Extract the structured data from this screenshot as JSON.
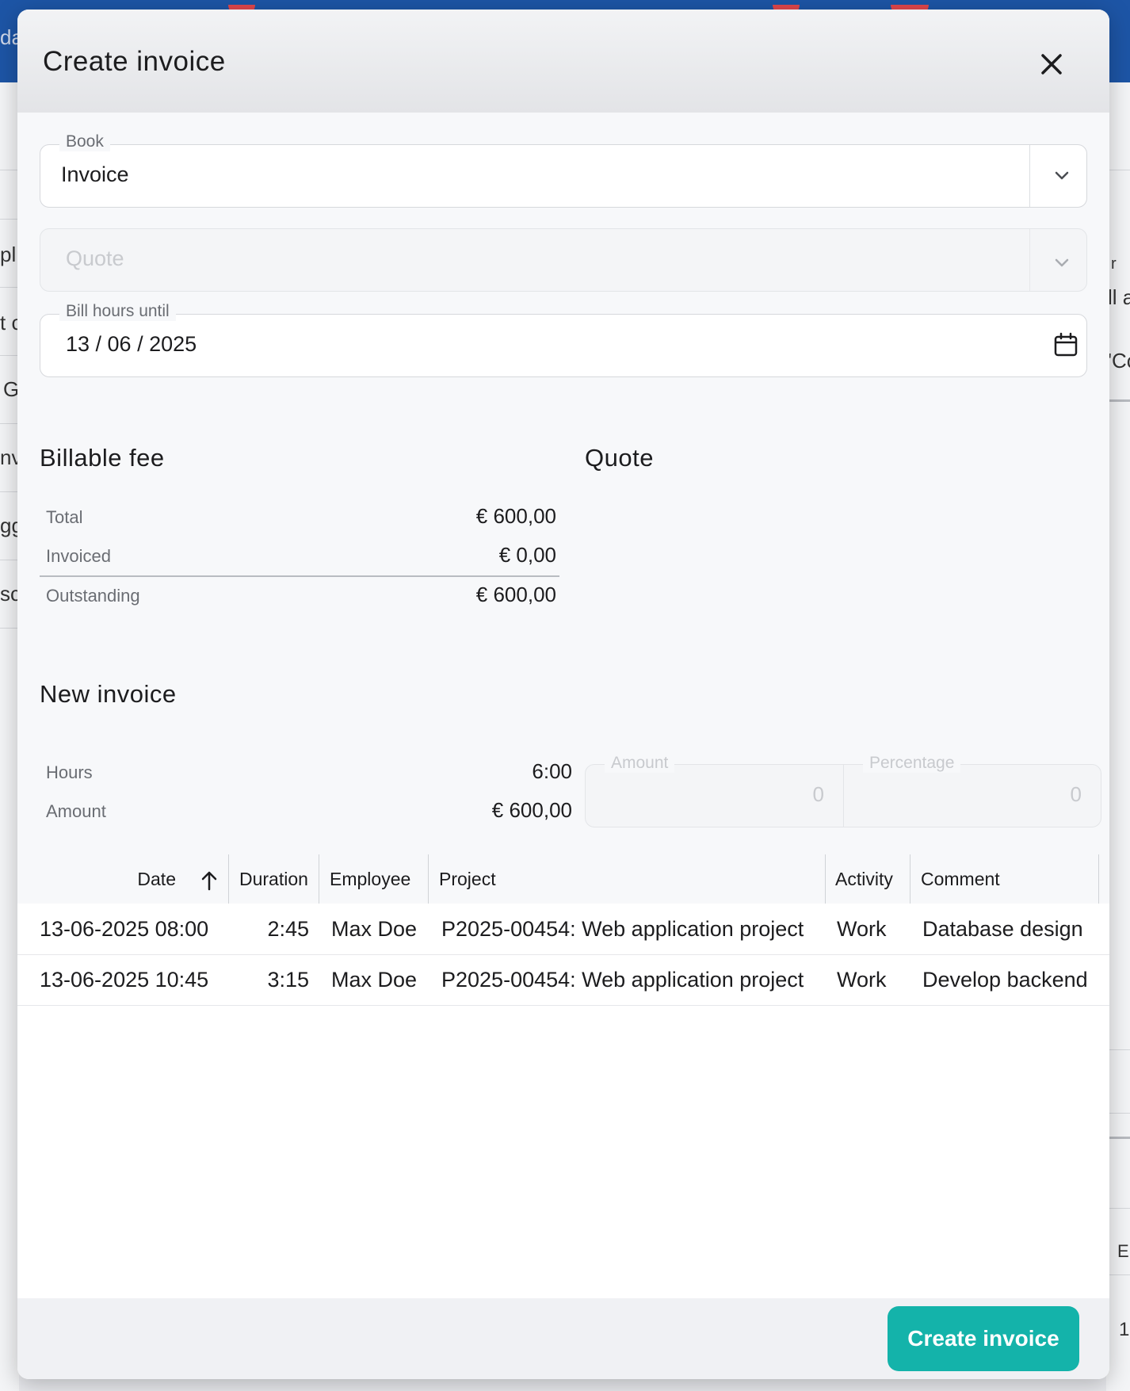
{
  "background": {
    "fragments_left": [
      "da",
      "pl",
      "t c",
      "G",
      "nv",
      "gg",
      "sc"
    ],
    "fragments_right": [
      "r",
      "ll a",
      "'Co",
      "E",
      "1"
    ]
  },
  "dialog": {
    "title": "Create invoice",
    "close_icon": "close-icon"
  },
  "fields": {
    "book": {
      "label": "Book",
      "value": "Invoice"
    },
    "quote": {
      "placeholder": "Quote"
    },
    "bill_until": {
      "label": "Bill hours until",
      "value": "13 / 06 / 2025"
    }
  },
  "billable_fee": {
    "title": "Billable fee",
    "rows": [
      {
        "label": "Total",
        "value": "€ 600,00"
      },
      {
        "label": "Invoiced",
        "value": "€ 0,00"
      },
      {
        "label": "Outstanding",
        "value": "€ 600,00"
      }
    ]
  },
  "quote_section": {
    "title": "Quote"
  },
  "new_invoice": {
    "title": "New invoice",
    "rows": [
      {
        "label": "Hours",
        "value": "6:00"
      },
      {
        "label": "Amount",
        "value": "€ 600,00"
      }
    ],
    "amount_field": {
      "label": "Amount",
      "value": "0"
    },
    "percentage_field": {
      "label": "Percentage",
      "value": "0"
    }
  },
  "table": {
    "columns": [
      "Date",
      "Duration",
      "Employee",
      "Project",
      "Activity",
      "Comment"
    ],
    "sort_icon": "arrow-up-icon",
    "rows": [
      [
        "13-06-2025 08:00",
        "2:45",
        "Max Doe",
        "P2025-00454: Web application project",
        "Work",
        "Database design"
      ],
      [
        "13-06-2025 10:45",
        "3:15",
        "Max Doe",
        "P2025-00454: Web application project",
        "Work",
        "Develop backend"
      ]
    ]
  },
  "footer": {
    "create_label": "Create invoice"
  },
  "colors": {
    "topbar": "#1d55a6",
    "accent": "#14b3aa",
    "badge": "#e0474c"
  }
}
